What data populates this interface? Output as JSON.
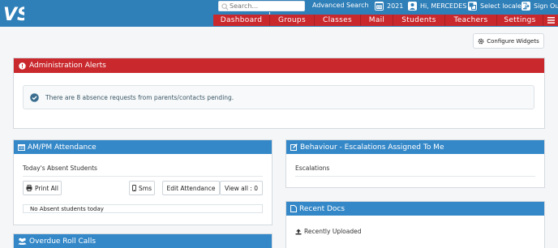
{
  "header": {
    "logo_text": "VS",
    "search_placeholder": "Search...",
    "advanced_search": "Advanced Search",
    "year": "2021",
    "greeting": "Hi, MERCEDES",
    "select_locale": "Select locale",
    "sign_out": "Sign Out"
  },
  "nav": {
    "items": [
      "Dashboard",
      "Groups",
      "Classes",
      "Mail",
      "Students",
      "Teachers",
      "Settings"
    ]
  },
  "toolbar": {
    "configure_widgets": "Configure Widgets"
  },
  "alerts": {
    "title": "Administration Alerts",
    "message": "There are 8 absence requests from parents/contacts pending."
  },
  "attendance": {
    "title": "AM/PM Attendance",
    "subtitle": "Today's Absent Students",
    "print_all": "Print All",
    "sms": "Sms",
    "edit_attendance": "Edit Attendance",
    "view_all": "View all : 0",
    "empty_message": "No Absent students today"
  },
  "rollcalls": {
    "title": "Overdue Roll Calls"
  },
  "behaviour": {
    "title": "Behaviour - Escalations Assigned To Me",
    "row": "Escalations"
  },
  "docs": {
    "title": "Recent Docs",
    "recently_uploaded": "Recently Uploaded"
  },
  "colors": {
    "topbar": "#2f7fb8",
    "nav": "#c9282d",
    "alert_header": "#c9282d",
    "panel_header": "#3588c8"
  }
}
